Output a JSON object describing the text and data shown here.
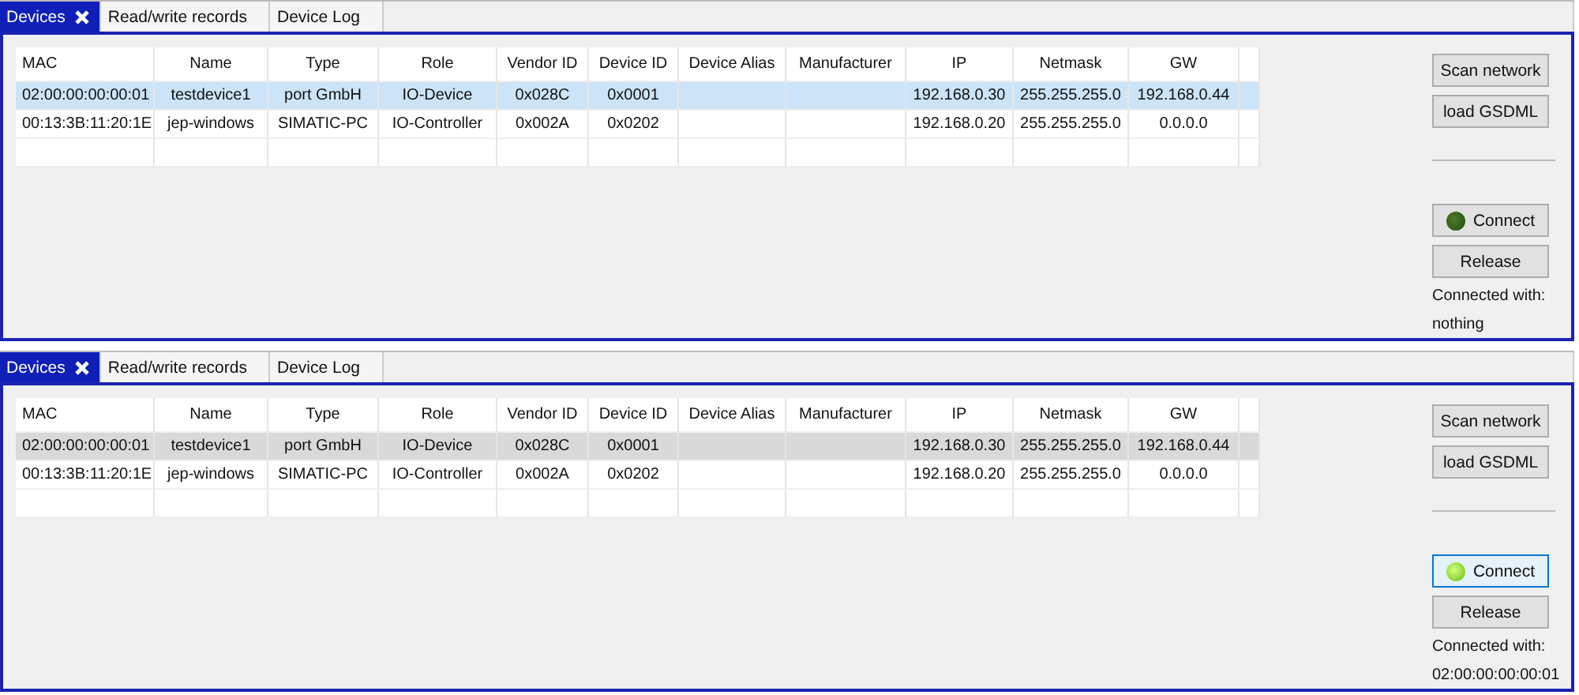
{
  "panels": [
    {
      "focused": true,
      "tabs": [
        {
          "label": "Devices",
          "selected": true,
          "closable": true
        },
        {
          "label": "Read/write records",
          "selected": false,
          "closable": false
        },
        {
          "label": "Device Log",
          "selected": false,
          "closable": false
        }
      ],
      "table": {
        "columns": [
          "MAC",
          "Name",
          "Type",
          "Role",
          "Vendor ID",
          "Device ID",
          "Device Alias",
          "Manufacturer",
          "IP",
          "Netmask",
          "GW"
        ],
        "rows": [
          {
            "selected": true,
            "cells": [
              "02:00:00:00:00:01",
              "testdevice1",
              "port GmbH",
              "IO-Device",
              "0x028C",
              "0x0001",
              "",
              "",
              "192.168.0.30",
              "255.255.255.0",
              "192.168.0.44"
            ]
          },
          {
            "selected": false,
            "cells": [
              "00:13:3B:11:20:1E",
              "jep-windows",
              "SIMATIC-PC",
              "IO-Controller",
              "0x002A",
              "0x0202",
              "",
              "",
              "192.168.0.20",
              "255.255.255.0",
              "0.0.0.0"
            ]
          }
        ]
      },
      "buttons": {
        "scan": "Scan network",
        "load": "load GSDML",
        "connect": {
          "label": "Connect",
          "connected": false,
          "highlighted": false
        },
        "release": "Release"
      },
      "connected_label": "Connected with:",
      "connected_value": "nothing"
    },
    {
      "focused": false,
      "tabs": [
        {
          "label": "Devices",
          "selected": true,
          "closable": true
        },
        {
          "label": "Read/write records",
          "selected": false,
          "closable": false
        },
        {
          "label": "Device Log",
          "selected": false,
          "closable": false
        }
      ],
      "table": {
        "columns": [
          "MAC",
          "Name",
          "Type",
          "Role",
          "Vendor ID",
          "Device ID",
          "Device Alias",
          "Manufacturer",
          "IP",
          "Netmask",
          "GW"
        ],
        "rows": [
          {
            "selected": true,
            "cells": [
              "02:00:00:00:00:01",
              "testdevice1",
              "port GmbH",
              "IO-Device",
              "0x028C",
              "0x0001",
              "",
              "",
              "192.168.0.30",
              "255.255.255.0",
              "192.168.0.44"
            ]
          },
          {
            "selected": false,
            "cells": [
              "00:13:3B:11:20:1E",
              "jep-windows",
              "SIMATIC-PC",
              "IO-Controller",
              "0x002A",
              "0x0202",
              "",
              "",
              "192.168.0.20",
              "255.255.255.0",
              "0.0.0.0"
            ]
          }
        ]
      },
      "buttons": {
        "scan": "Scan network",
        "load": "load GSDML",
        "connect": {
          "label": "Connect",
          "connected": true,
          "highlighted": true
        },
        "release": "Release"
      },
      "connected_label": "Connected with:",
      "connected_value": "02:00:00:00:00:01"
    }
  ]
}
